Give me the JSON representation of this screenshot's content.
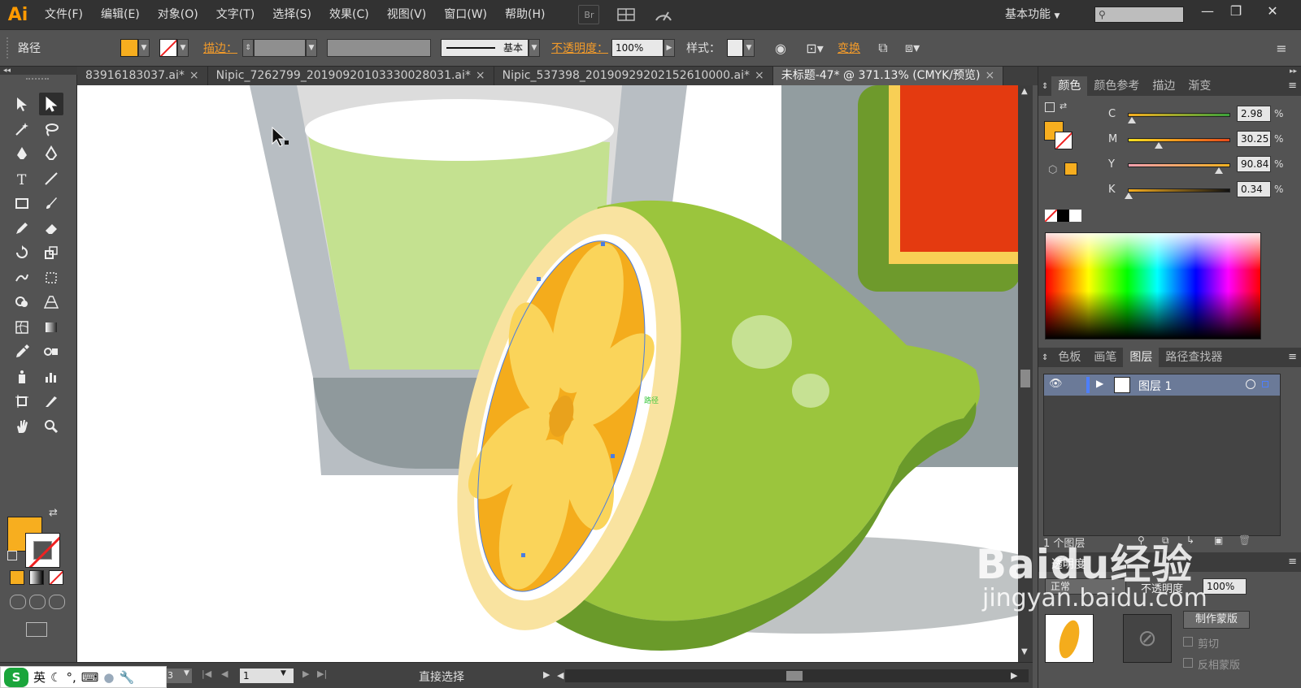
{
  "app": {
    "logo": "Ai"
  },
  "menu": [
    "文件(F)",
    "编辑(E)",
    "对象(O)",
    "文字(T)",
    "选择(S)",
    "效果(C)",
    "视图(V)",
    "窗口(W)",
    "帮助(H)"
  ],
  "menu_icons": {
    "bridge": "Br",
    "arrange": "arrange-documents-icon",
    "gpu": "gpu-performance-icon"
  },
  "workspace": {
    "label": "基本功能"
  },
  "search": {
    "placeholder": ""
  },
  "window_controls": {
    "minimize": "minimize-icon",
    "restore": "restore-icon",
    "close": "close-icon"
  },
  "controlbar": {
    "selection_label": "路径",
    "stroke_label": "描边：",
    "stroke_style": "基本",
    "opacity_label": "不透明度：",
    "opacity_value": "100%",
    "style_label": "样式：",
    "transform_label": "变换",
    "fill_color": "#f7ae1f"
  },
  "tabs": [
    {
      "label": "83916183037.ai*",
      "active": false
    },
    {
      "label": "Nipic_7262799_20190920103330028031.ai*",
      "active": false
    },
    {
      "label": "Nipic_537398_20190929202152610000.ai*",
      "active": false
    },
    {
      "label": "未标题-47* @ 371.13% (CMYK/预览)",
      "active": true
    }
  ],
  "tabs_overflow": "»",
  "tools": [
    "selection-tool",
    "direct-selection-tool",
    "magic-wand-tool",
    "lasso-tool",
    "pen-tool",
    "curvature-tool",
    "type-tool",
    "line-tool",
    "rectangle-tool",
    "paintbrush-tool",
    "pencil-tool",
    "eraser-tool",
    "rotate-tool",
    "scale-tool",
    "warp-tool",
    "free-transform-tool",
    "shape-builder-tool",
    "perspective-grid-tool",
    "mesh-tool",
    "gradient-tool",
    "eyedropper-tool",
    "blend-tool",
    "symbol-sprayer-tool",
    "column-graph-tool",
    "artboard-tool",
    "slice-tool",
    "hand-tool",
    "zoom-tool"
  ],
  "tool_colors": {
    "fill": "#f7ae1f",
    "stroke": "none"
  },
  "canvas": {
    "anchor_label": "路径"
  },
  "status": {
    "zoom": "3",
    "page": "1",
    "tool": "直接选择"
  },
  "ime": {
    "brand": "S",
    "lang": "英",
    "icons": [
      "moon-icon",
      "punctuation-icon",
      "keyboard-icon",
      "user-icon",
      "wrench-icon"
    ]
  },
  "color_panel": {
    "tabs": [
      "颜色",
      "颜色参考",
      "描边",
      "渐变"
    ],
    "channels": [
      {
        "label": "C",
        "value": "2.98",
        "percent": 0.03
      },
      {
        "label": "M",
        "value": "30.25",
        "percent": 0.3
      },
      {
        "label": "Y",
        "value": "90.84",
        "percent": 0.91
      },
      {
        "label": "K",
        "value": "0.34",
        "percent": 0.0
      }
    ],
    "pct": "%"
  },
  "layers_panel": {
    "tabs": [
      "色板",
      "画笔",
      "图层",
      "路径查找器"
    ],
    "layer_name": "图层 1",
    "count": "1 个图层"
  },
  "transparency_panel": {
    "title": "透明度",
    "mode": "正常",
    "opacity_label": "不透明度",
    "opacity_value": "100%",
    "make_mask": "制作蒙版",
    "clip": "剪切",
    "invert": "反相蒙版"
  },
  "watermark": {
    "brand": "Baidu经验",
    "url": "jingyan.baidu.com"
  }
}
